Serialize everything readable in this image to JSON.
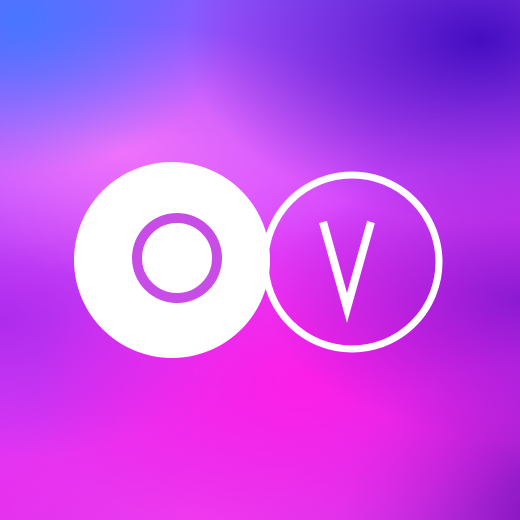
{
  "logo": {
    "letters": [
      "O",
      "V"
    ],
    "colors": {
      "white": "#ffffff",
      "letter_o_fill": "#c84ce6",
      "ring_inner": "#f23ee4",
      "bg_top_left": "#4a78ff",
      "bg_top_right": "#3e0abe",
      "bg_center": "#e22cf0",
      "bg_bottom": "#f03cf0"
    },
    "icons": [
      "letter-o-circle-icon",
      "letter-v-ring-icon"
    ]
  }
}
